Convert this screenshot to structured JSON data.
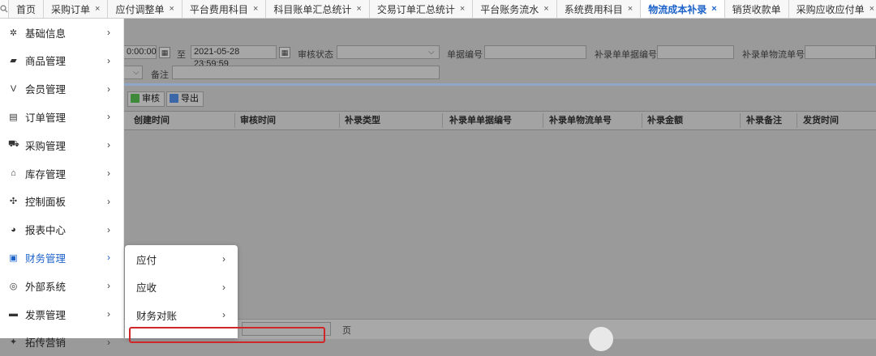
{
  "tabs": [
    {
      "label": "首页",
      "closable": false,
      "active": false
    },
    {
      "label": "采购订单",
      "closable": true,
      "active": false
    },
    {
      "label": "应付调整单",
      "closable": true,
      "active": false
    },
    {
      "label": "平台费用科目",
      "closable": true,
      "active": false
    },
    {
      "label": "科目账单汇总统计",
      "closable": true,
      "active": false
    },
    {
      "label": "交易订单汇总统计",
      "closable": true,
      "active": false
    },
    {
      "label": "平台账务流水",
      "closable": true,
      "active": false
    },
    {
      "label": "系统费用科目",
      "closable": true,
      "active": false
    },
    {
      "label": "物流成本补录",
      "closable": true,
      "active": true
    },
    {
      "label": "销货收款单",
      "closable": false,
      "active": false
    },
    {
      "label": "采购应收应付单",
      "closable": true,
      "active": false
    }
  ],
  "tab_close_glyph": "×",
  "filters": {
    "start_time_partial": "0:00:00",
    "range_sep": "至",
    "end_time": "2021-05-28 23:59:59",
    "audit_status_label": "审核状态",
    "doc_no_label": "单据编号",
    "supp_doc_no_label": "补录单单据编号",
    "supp_logistics_no_label": "补录单物流单号",
    "remark_label": "备注"
  },
  "toolbar": {
    "audit_label": "审核",
    "export_label": "导出"
  },
  "grid": {
    "columns": [
      "创建时间",
      "审核时间",
      "补录类型",
      "补录单单据编号",
      "补录单物流单号",
      "补录金额",
      "补录备注",
      "发货时间"
    ]
  },
  "bottom": {
    "partial_text": "页"
  },
  "sidebar": {
    "items": [
      {
        "label": "基础信息",
        "icon": "gear-icon",
        "glyph": "✲",
        "active": false
      },
      {
        "label": "商品管理",
        "icon": "shop-icon",
        "glyph": "▰",
        "active": false
      },
      {
        "label": "会员管理",
        "icon": "member-icon",
        "glyph": "V",
        "active": false
      },
      {
        "label": "订单管理",
        "icon": "order-icon",
        "glyph": "▤",
        "active": false
      },
      {
        "label": "采购管理",
        "icon": "cart-icon",
        "glyph": "⛟",
        "active": false
      },
      {
        "label": "库存管理",
        "icon": "warehouse-icon",
        "glyph": "⌂",
        "active": false
      },
      {
        "label": "控制面板",
        "icon": "dashboard-icon",
        "glyph": "✣",
        "active": false
      },
      {
        "label": "报表中心",
        "icon": "report-icon",
        "glyph": "◕",
        "active": false
      },
      {
        "label": "财务管理",
        "icon": "finance-icon",
        "glyph": "▣",
        "active": true
      },
      {
        "label": "外部系统",
        "icon": "external-icon",
        "glyph": "◎",
        "active": false
      },
      {
        "label": "发票管理",
        "icon": "invoice-icon",
        "glyph": "▬",
        "active": false
      },
      {
        "label": "拓传营销",
        "icon": "marketing-icon",
        "glyph": "✦",
        "active": false
      }
    ],
    "arrow_glyph": "›"
  },
  "submenu": {
    "items": [
      {
        "label": "应付"
      },
      {
        "label": "应收"
      },
      {
        "label": "财务对账"
      }
    ]
  },
  "colors": {
    "accent": "#1e63c9",
    "highlight_border": "#d0262a"
  }
}
